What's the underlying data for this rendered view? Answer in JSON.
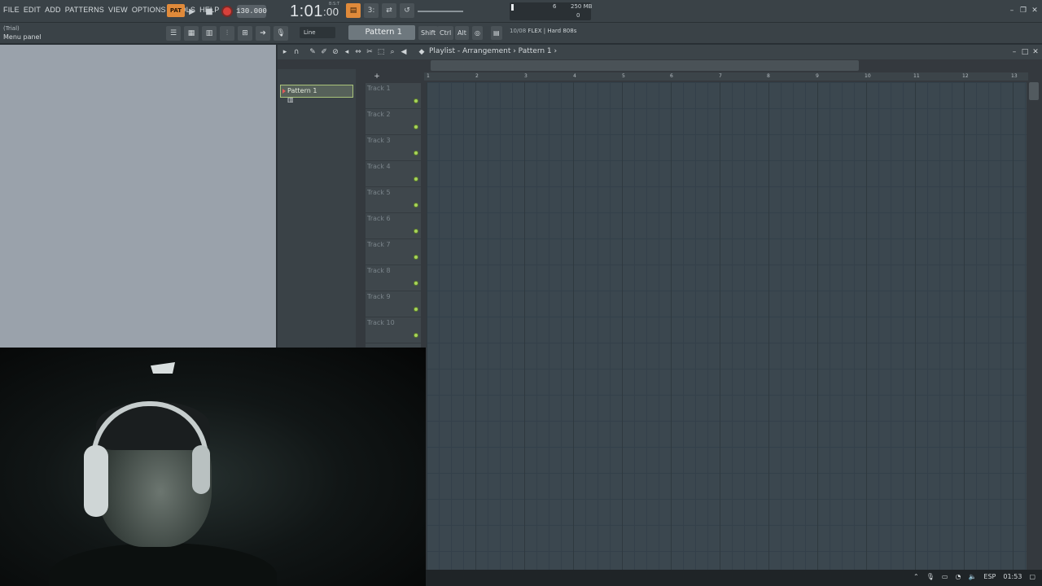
{
  "menu": {
    "items": [
      "FILE",
      "EDIT",
      "ADD",
      "PATTERNS",
      "VIEW",
      "OPTIONS",
      "TOOLS",
      "HELP"
    ]
  },
  "transport": {
    "mode_label": "PAT",
    "tempo": "130.000",
    "time": "1:01",
    "time_sub": ":00",
    "time_caption": "B:S:T"
  },
  "status": {
    "cpu": "6",
    "ram": "250 MB",
    "polyphony": "0"
  },
  "hint_panel": {
    "trial": "(Trial)",
    "hint": "Menu panel"
  },
  "toolbar": {
    "snap": "Line",
    "pattern": "Pattern 1",
    "shift": "Shift",
    "ctrl": "Ctrl",
    "alt": "Alt",
    "news_count": "10/08",
    "news_text": "FLEX | Hard 808s"
  },
  "playlist": {
    "title": "Playlist - Arrangement › Pattern 1 ›",
    "patterns": [
      "Pattern 1"
    ],
    "tracks": [
      "Track 1",
      "Track 2",
      "Track 3",
      "Track 4",
      "Track 5",
      "Track 6",
      "Track 7",
      "Track 8",
      "Track 9",
      "Track 10"
    ],
    "bars": [
      "1",
      "2",
      "3",
      "4",
      "5",
      "6",
      "7",
      "8",
      "9",
      "10",
      "11",
      "12",
      "13"
    ]
  },
  "taskbar": {
    "language": "ESP",
    "clock": "01:53"
  },
  "colors": {
    "accent_orange": "#e08a3a",
    "record_red": "#d7413b",
    "led_green": "#a7d45a"
  }
}
